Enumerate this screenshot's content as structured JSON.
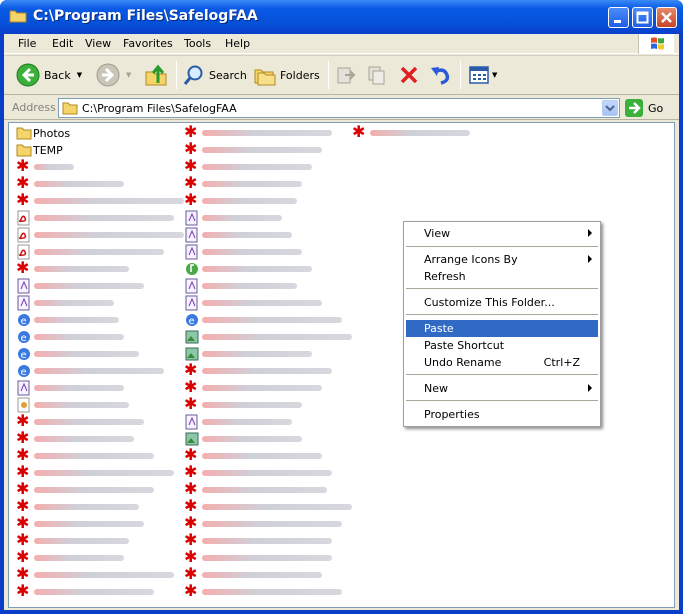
{
  "window": {
    "title": "C:\\Program Files\\SafelogFAA",
    "controls": [
      "minimize",
      "maximize",
      "close"
    ]
  },
  "menubar": {
    "items": [
      "File",
      "Edit",
      "View",
      "Favorites",
      "Tools",
      "Help"
    ]
  },
  "toolbar": {
    "back_label": "Back",
    "search_label": "Search",
    "folders_label": "Folders"
  },
  "addressbar": {
    "label": "Address",
    "value": "C:\\Program Files\\SafelogFAA",
    "go_label": "Go"
  },
  "files": {
    "folders": [
      "Photos",
      "TEMP"
    ]
  },
  "context_menu": {
    "items": [
      {
        "label": "View",
        "submenu": true
      },
      {
        "label": "Arrange Icons By",
        "submenu": true
      },
      {
        "label": "Refresh"
      },
      {
        "label": "Customize This Folder..."
      },
      {
        "label": "Paste",
        "highlighted": true
      },
      {
        "label": "Paste Shortcut"
      },
      {
        "label": "Undo Rename",
        "shortcut": "Ctrl+Z"
      },
      {
        "label": "New",
        "submenu": true
      },
      {
        "label": "Properties"
      }
    ]
  },
  "colors": {
    "titlebar": "#0a5ae6",
    "menu_highlight": "#316ac5",
    "chrome": "#ece9d8"
  }
}
